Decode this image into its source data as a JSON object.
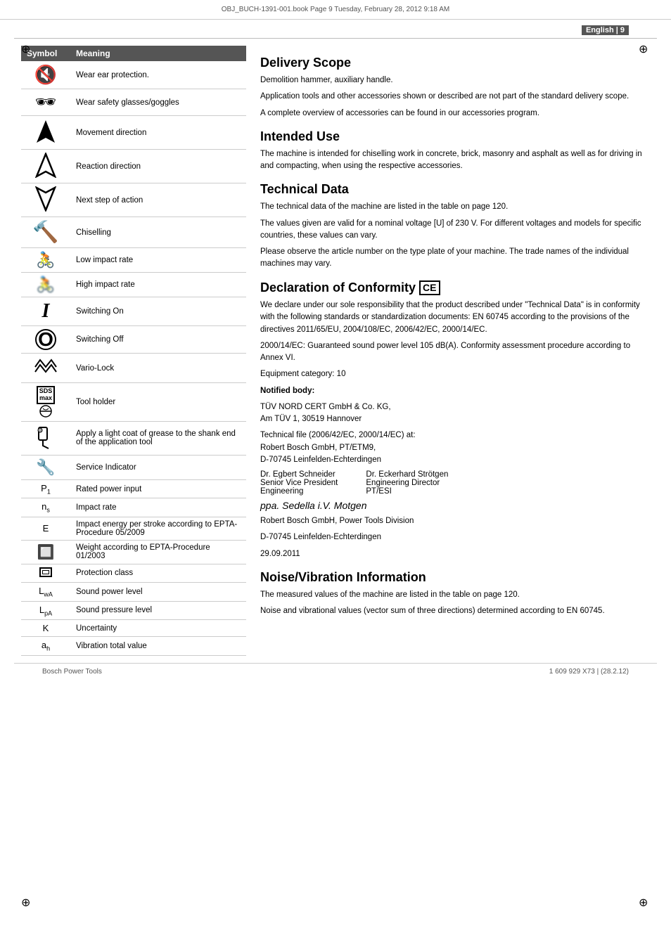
{
  "page": {
    "file_info": "OBJ_BUCH-1391-001.book  Page 9  Tuesday, February 28, 2012  9:18 AM",
    "lang_label": "English | 9",
    "footer_left": "Bosch Power Tools",
    "footer_right": "1 609 929 X73 | (28.2.12)"
  },
  "symbol_table": {
    "col_symbol": "Symbol",
    "col_meaning": "Meaning",
    "rows": [
      {
        "symbol": "ear",
        "meaning": "Wear ear protection."
      },
      {
        "symbol": "eye",
        "meaning": "Wear safety glasses/goggles"
      },
      {
        "symbol": "arrow_up_filled",
        "meaning": "Movement direction"
      },
      {
        "symbol": "arrow_up_outline",
        "meaning": "Reaction direction"
      },
      {
        "symbol": "arrow_down_outline",
        "meaning": "Next step of action"
      },
      {
        "symbol": "chisel_T",
        "meaning": "Chiselling"
      },
      {
        "symbol": "bike_low",
        "meaning": "Low impact rate"
      },
      {
        "symbol": "bike_high",
        "meaning": "High impact rate"
      },
      {
        "symbol": "switch_on_I",
        "meaning": "Switching On"
      },
      {
        "symbol": "switch_off_O",
        "meaning": "Switching Off"
      },
      {
        "symbol": "vario_lock",
        "meaning": "Vario-Lock"
      },
      {
        "symbol": "sds_tool",
        "meaning": "Tool holder"
      },
      {
        "symbol": "grease",
        "meaning": "Apply a light coat of grease to the shank end of the application tool"
      },
      {
        "symbol": "wrench",
        "meaning": "Service Indicator"
      },
      {
        "symbol": "P1",
        "meaning": "Rated power input"
      },
      {
        "symbol": "ns",
        "meaning": "Impact rate"
      },
      {
        "symbol": "E",
        "meaning": "Impact energy per stroke according to EPTA-Procedure 05/2009"
      },
      {
        "symbol": "weight_black",
        "meaning": "Weight according to EPTA-Procedure 01/2003"
      },
      {
        "symbol": "prot_class",
        "meaning": "Protection class"
      },
      {
        "symbol": "Lwa",
        "meaning": "Sound power level"
      },
      {
        "symbol": "Lpa",
        "meaning": "Sound pressure level"
      },
      {
        "symbol": "K",
        "meaning": "Uncertainty"
      },
      {
        "symbol": "ah",
        "meaning": "Vibration total value"
      }
    ]
  },
  "delivery_scope": {
    "title": "Delivery Scope",
    "para1": "Demolition hammer, auxiliary handle.",
    "para2": "Application tools and other accessories shown or described are not part of the standard delivery scope.",
    "para3": "A complete overview of accessories can be found in our accessories program."
  },
  "intended_use": {
    "title": "Intended Use",
    "body": "The machine is intended for chiselling work in concrete, brick, masonry and asphalt as well as for driving in and compacting, when using the respective accessories."
  },
  "technical_data": {
    "title": "Technical Data",
    "para1": "The technical data of the machine are listed in the table on page 120.",
    "para2": "The values given are valid for a nominal voltage [U] of 230 V. For different voltages and models for specific countries, these values can vary.",
    "para3": "Please observe the article number on the type plate of your machine. The trade names of the individual machines may vary."
  },
  "declaration": {
    "title": "Declaration of Conformity",
    "ce_mark": "CE",
    "body1": "We declare under our sole responsibility that the product described under \"Technical Data\" is in conformity with the following standards or standardization documents: EN 60745 according to the provisions of the directives 2011/65/EU, 2004/108/EC, 2006/42/EC, 2000/14/EC.",
    "body2": "2000/14/EC: Guaranteed sound power level 105 dB(A). Conformity assessment procedure according to Annex VI.",
    "equipment_cat": "Equipment category: 10",
    "notified_body_label": "Notified body:",
    "notified_body": "TÜV NORD CERT GmbH & Co. KG,\nAm TÜV 1, 30519 Hannover",
    "tech_file": "Technical file (2006/42/EC, 2000/14/EC) at:\nRobert Bosch GmbH, PT/ETM9,\nD-70745 Leinfelden-Echterdingen",
    "person1_name": "Dr. Egbert Schneider",
    "person1_title1": "Senior Vice President",
    "person1_title2": "Engineering",
    "person2_name": "Dr. Eckerhard Strötgen",
    "person2_title1": "Engineering Director",
    "person2_title2": "PT/ESI",
    "signature_text": "ppa. Sedella    i.V. Motgen",
    "company": "Robert Bosch GmbH, Power Tools Division",
    "address": "D-70745 Leinfelden-Echterdingen",
    "date": "29.09.2011"
  },
  "noise_vibration": {
    "title": "Noise/Vibration Information",
    "para1": "The measured values of the machine are listed in the table on page 120.",
    "para2": "Noise and vibrational values (vector sum of three directions) determined according to EN 60745."
  }
}
